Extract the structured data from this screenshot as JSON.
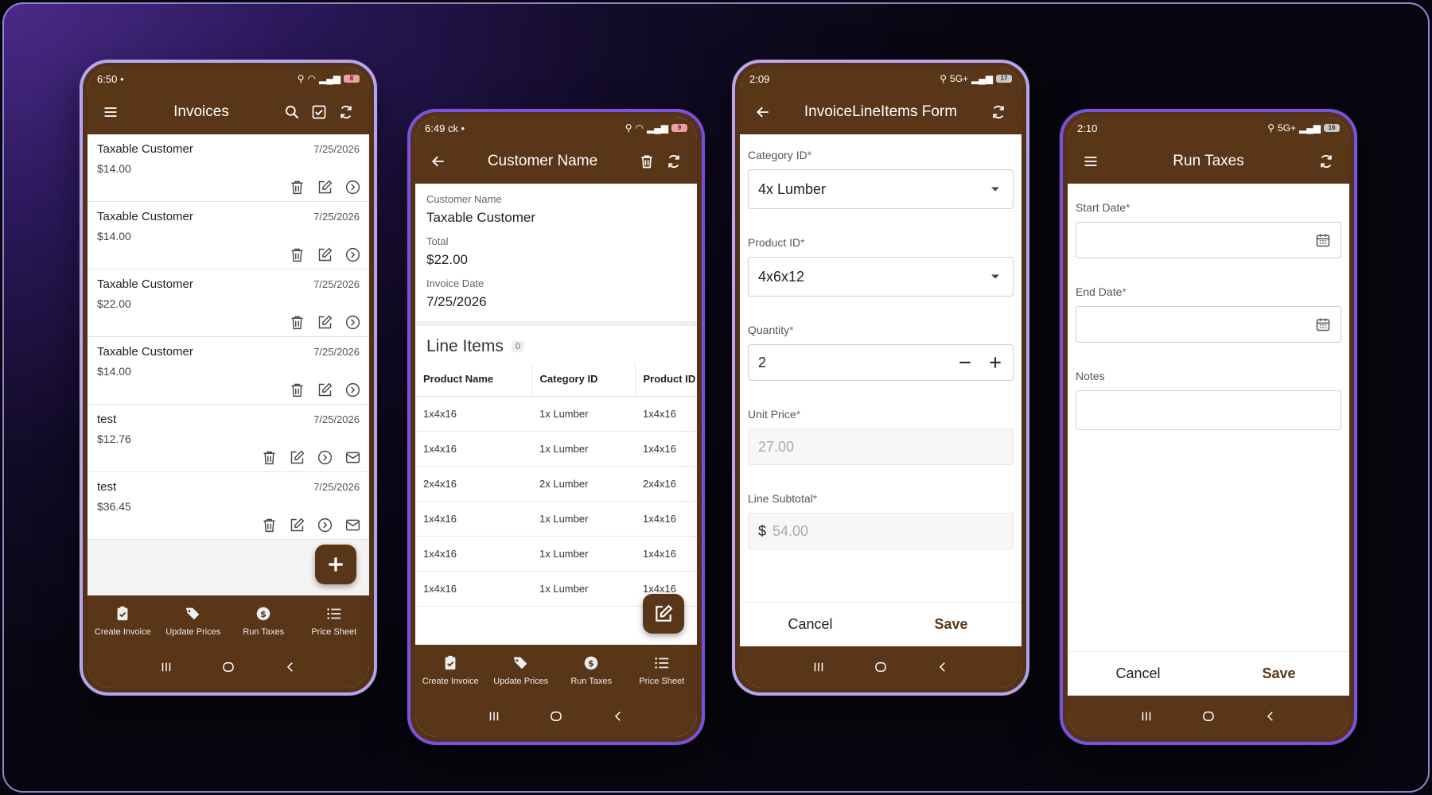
{
  "colors": {
    "brand": "#5a3619",
    "accent": "#7a52e0"
  },
  "bottom_nav": [
    {
      "label": "Create Invoice",
      "icon": "clipboard-check-icon"
    },
    {
      "label": "Update Prices",
      "icon": "tags-icon"
    },
    {
      "label": "Run Taxes",
      "icon": "dollar-badge-icon"
    },
    {
      "label": "Price Sheet",
      "icon": "list-icon"
    }
  ],
  "phone1": {
    "status": {
      "time": "6:50",
      "extras": "•",
      "battery": "8"
    },
    "title": "Invoices",
    "items": [
      {
        "name": "Taxable Customer",
        "amount": "$14.00",
        "date": "7/25/2026"
      },
      {
        "name": "Taxable Customer",
        "amount": "$14.00",
        "date": "7/25/2026"
      },
      {
        "name": "Taxable Customer",
        "amount": "$22.00",
        "date": "7/25/2026"
      },
      {
        "name": "Taxable Customer",
        "amount": "$14.00",
        "date": "7/25/2026"
      },
      {
        "name": "test",
        "amount": "$12.76",
        "date": "7/25/2026"
      },
      {
        "name": "test",
        "amount": "$36.45",
        "date": "7/25/2026"
      }
    ]
  },
  "phone2": {
    "status": {
      "time": "6:49",
      "extras": "ck •",
      "battery": "9"
    },
    "title": "Customer Name",
    "fields": [
      {
        "label": "Customer Name",
        "value": "Taxable Customer"
      },
      {
        "label": "Total",
        "value": "$22.00"
      },
      {
        "label": "Invoice Date",
        "value": "7/25/2026"
      }
    ],
    "section_title": "Line Items",
    "section_count": "0",
    "columns": [
      "Product Name",
      "Category ID",
      "Product ID"
    ],
    "rows": [
      [
        "1x4x16",
        "1x Lumber",
        "1x4x16"
      ],
      [
        "1x4x16",
        "1x Lumber",
        "1x4x16"
      ],
      [
        "2x4x16",
        "2x Lumber",
        "2x4x16"
      ],
      [
        "1x4x16",
        "1x Lumber",
        "1x4x16"
      ],
      [
        "1x4x16",
        "1x Lumber",
        "1x4x16"
      ],
      [
        "1x4x16",
        "1x Lumber",
        "1x4x16"
      ]
    ]
  },
  "phone3": {
    "status": {
      "time": "2:09",
      "network": "5G+",
      "battery": "17"
    },
    "title": "InvoiceLineItems Form",
    "category_label": "Category ID",
    "category_value": "4x Lumber",
    "product_label": "Product ID",
    "product_value": "4x6x12",
    "quantity_label": "Quantity",
    "quantity_value": "2",
    "unit_price_label": "Unit Price",
    "unit_price_value": "27.00",
    "subtotal_label": "Line Subtotal",
    "subtotal_prefix": "$",
    "subtotal_value": "54.00",
    "cancel": "Cancel",
    "save": "Save"
  },
  "phone4": {
    "status": {
      "time": "2:10",
      "network": "5G+",
      "battery": "16"
    },
    "title": "Run Taxes",
    "start_label": "Start Date",
    "end_label": "End Date",
    "notes_label": "Notes",
    "cancel": "Cancel",
    "save": "Save"
  },
  "required_mark": "*"
}
